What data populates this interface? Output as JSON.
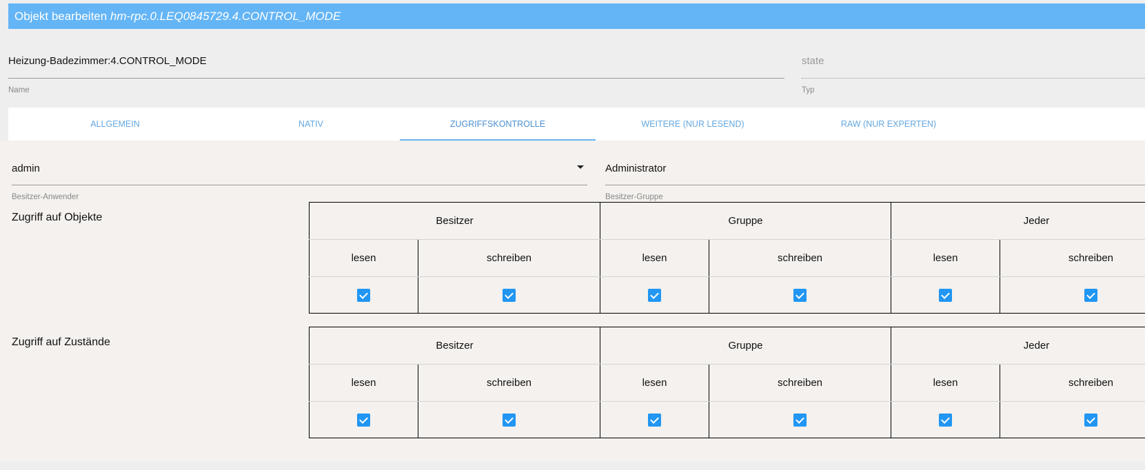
{
  "header": {
    "prefix": "Objekt bearbeiten ",
    "object_id": "hm-rpc.0.LEQ0845729.4.CONTROL_MODE"
  },
  "name_field": {
    "value": "Heizung-Badezimmer:4.CONTROL_MODE",
    "label": "Name"
  },
  "type_field": {
    "value": "state",
    "label": "Typ"
  },
  "tabs": [
    {
      "label": "ALLGEMEIN"
    },
    {
      "label": "NATIV"
    },
    {
      "label": "ZUGRIFFSKONTROLLE",
      "active": true
    },
    {
      "label": "WEITERE (NUR LESEND)"
    },
    {
      "label": "RAW (NUR EXPERTEN)"
    }
  ],
  "owner_user": {
    "value": "admin",
    "label": "Besitzer-Anwender"
  },
  "owner_group": {
    "value": "Administrator",
    "label": "Besitzer-Gruppe"
  },
  "acl": {
    "groups": [
      "Besitzer",
      "Gruppe",
      "Jeder"
    ],
    "read": "lesen",
    "write": "schreiben",
    "objects": {
      "title": "Zugriff auf Objekte",
      "checked": [
        true,
        true,
        true,
        true,
        true,
        true
      ]
    },
    "states": {
      "title": "Zugriff auf Zustände",
      "checked": [
        true,
        true,
        true,
        true,
        true,
        true
      ]
    }
  },
  "colors": {
    "accent": "#64b5f6",
    "checkbox": "#2196f3"
  }
}
